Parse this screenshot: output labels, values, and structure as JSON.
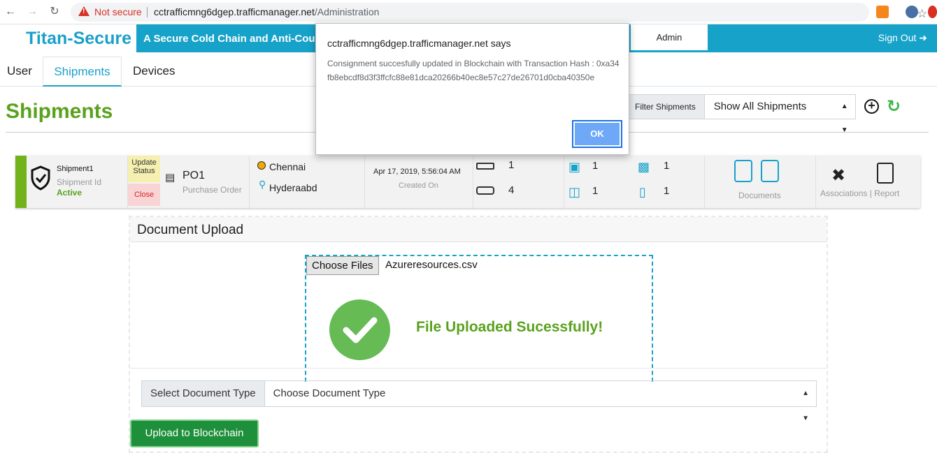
{
  "browser": {
    "not_secure": "Not secure",
    "url_host": "cctrafficmng6dgep.trafficmanager.net",
    "url_path": "/Administration"
  },
  "header": {
    "brand": "Titan-Secure",
    "tagline": "A Secure Cold Chain and Anti-Counter",
    "admin_tab": "Admin",
    "sign_out": "Sign Out"
  },
  "tabs": [
    {
      "label": "User"
    },
    {
      "label": "Shipments"
    },
    {
      "label": "Devices"
    }
  ],
  "page": {
    "title": "Shipments",
    "filter_label": "Filter Shipments",
    "filter_value": "Show All Shipments"
  },
  "shipment": {
    "name": "Shipment1",
    "id_label": "Shipment Id",
    "status": "Active",
    "update_status": "Update Status",
    "close": "Close",
    "po": "PO1",
    "po_label": "Purchase Order",
    "origin": "Chennai",
    "destination": "Hyderaabd",
    "created": "Apr 17, 2019, 5:56:04 AM",
    "created_label": "Created On",
    "counts": {
      "router": "1",
      "gateway": "4",
      "pallet": "1",
      "box": "1",
      "package": "1",
      "tag": "1"
    },
    "documents_label": "Documents",
    "associations_label": "Associations",
    "report_label": "Report",
    "separator": "|"
  },
  "upload": {
    "title": "Document Upload",
    "choose_files": "Choose Files",
    "file_name": "Azureresources.csv",
    "success_message": "File Uploaded Sucessfully!",
    "doctype_label": "Select Document Type",
    "doctype_value": "Choose Document Type",
    "upload_button": "Upload to Blockchain"
  },
  "dialog": {
    "title": "cctrafficmng6dgep.trafficmanager.net says",
    "message": "Consignment succesfully updated in Blockchain with Transaction Hash : 0xa34fb8ebcdf8d3f3ffcfc88e81dca20266b40ec8e57c27de26701d0cba40350e",
    "ok": "OK"
  },
  "colors": {
    "brand": "#1ba0c9",
    "green": "#5aa21e",
    "upload_button": "#1e8f3a"
  }
}
